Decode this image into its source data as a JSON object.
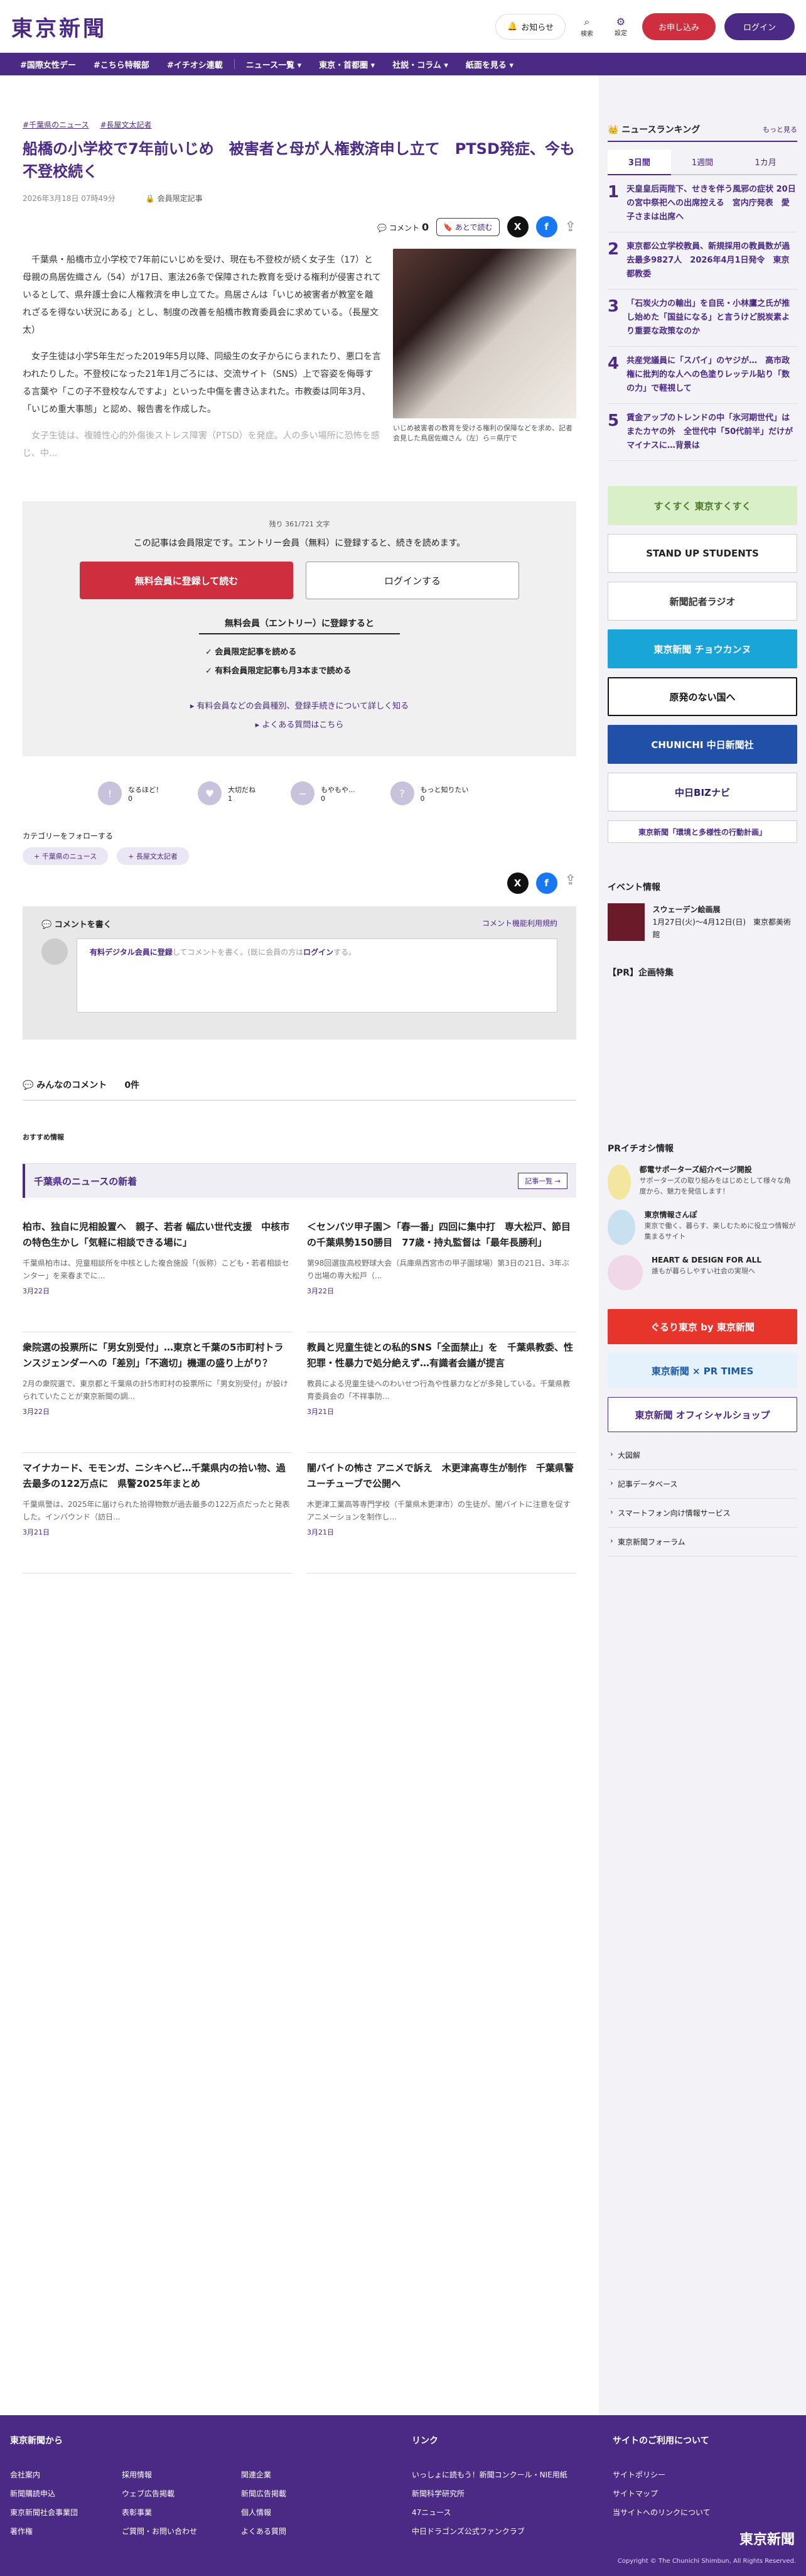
{
  "header": {
    "logo": "東京新聞",
    "notif": "お知らせ",
    "search": "検索",
    "settings": "設定",
    "apply": "お申し込み",
    "login": "ログイン"
  },
  "nav": [
    "#国際女性デー",
    "#こちら特報部",
    "#イチオシ連載",
    "ニュース一覧",
    "東京・首都圏",
    "社説・コラム",
    "紙面を見る"
  ],
  "article": {
    "tags": [
      "千葉県のニュース",
      "長屋文太記者"
    ],
    "title": "船橋の小学校で7年前いじめ　被害者と母が人権救済申し立て　PTSD発症、今も不登校続く",
    "date": "2026年3月18日 07時49分",
    "lock": "会員限定記事",
    "comment_label": "コメント",
    "comment_count": "0",
    "later": "あとで読む",
    "p1": "千葉県・船橋市立小学校で7年前にいじめを受け、現在も不登校が続く女子生（17）と母親の鳥居佐織さん（54）が17日、憲法26条で保障された教育を受ける権利が侵害されているとして、県弁護士会に人権救済を申し立てた。鳥居さんは「いじめ被害者が教室を離れざるを得ない状況にある」とし、制度の改善を船橋市教育委員会に求めている。（長屋文太）",
    "p2": "女子生徒は小学5年生だった2019年5月以降、同級生の女子からにらまれたり、悪口を言われたりした。不登校になった21年1月ごろには、交流サイト（SNS）上で容姿を侮辱する言葉や「この子不登校なんですよ」といった中傷を書き込まれた。市教委は同年3月、「いじめ重大事態」と認め、報告書を作成した。",
    "p3": "女子生徒は、複雑性心的外傷後ストレス障害（PTSD）を発症。人の多い場所に恐怖を感じ、中...",
    "caption": "いじめ被害者の教育を受ける権利の保障などを求め、記者会見した鳥居佐織さん（左）ら＝県庁で"
  },
  "gate": {
    "rest": "残り 361/721 文字",
    "msg": "この記事は会員限定です。エントリー会員（無料）に登録すると、続きを読めます。",
    "register": "無料会員に登録して読む",
    "login": "ログインする",
    "free_title": "無料会員（エントリー）に登録すると",
    "check1": "会員限定記事を読める",
    "check2": "有料会員限定記事も月3本まで読める",
    "link1": "有料会員などの会員種別、登録手続きについて詳しく知る",
    "link2": "よくある質問はこちら"
  },
  "reactions": [
    {
      "label": "なるほど！",
      "count": "0"
    },
    {
      "label": "大切だね",
      "count": "1"
    },
    {
      "label": "もやもや...",
      "count": "0"
    },
    {
      "label": "もっと知りたい",
      "count": "0"
    }
  ],
  "follow": {
    "title": "カテゴリーをフォローする",
    "chips": [
      "千葉県のニュース",
      "長屋文太記者"
    ]
  },
  "comments": {
    "write": "コメントを書く",
    "rules": "コメント機能利用規約",
    "ph1": "有料デジタル会員に登録",
    "ph2": "してコメントを書く。(既に会員の方は",
    "ph3": "ログイン",
    "ph4": "する。",
    "all": "みんなのコメント",
    "count": "0件"
  },
  "rec": "おすすめ情報",
  "news": {
    "title": "千葉県のニュースの新着",
    "more": "記事一覧",
    "items": [
      {
        "t": "柏市、独自に児相設置へ　親子、若者 幅広い世代支援　中核市の特色生かし「気軽に相談できる場に」",
        "b": "千葉県柏市は、児童相談所を中核とした複合施設「(仮称）こども・若者相談センター」を来春までに...",
        "d": "3月22日"
      },
      {
        "t": "＜センバツ甲子園＞「春一番」四回に集中打　専大松戸、節目の千葉県勢150勝目　77歳・持丸監督は「最年長勝利」",
        "b": "第98回選抜高校野球大会（兵庫県西宮市の甲子園球場）第3日の21日、3年ぶり出場の専大松戸（...",
        "d": "3月22日"
      },
      {
        "t": "衆院選の投票所に「男女別受付」…東京と千葉の5市町村トランスジェンダーへの「差別」「不適切」機運の盛り上がり？",
        "b": "2月の衆院選で、東京都と千葉県の計5市町村の投票所に「男女別受付」が設けられていたことが東京新聞の調...",
        "d": "3月22日"
      },
      {
        "t": "教員と児童生徒との私的SNS「全面禁止」を　千葉県教委、性犯罪・性暴力で処分絶えず…有識者会議が提言",
        "b": "教員による児童生徒へのわいせつ行為や性暴力などが多発している。千葉県教育委員会の「不祥事防...",
        "d": "3月21日"
      },
      {
        "t": "マイナカード、モモンガ、ニシキヘビ…千葉県内の拾い物、過去最多の122万点に　県警2025年まとめ",
        "b": "千葉県警は、2025年に届けられた拾得物数が過去最多の122万点だったと発表した。インバウンド（訪日...",
        "d": "3月21日"
      },
      {
        "t": "闇バイトの怖さ アニメで訴え　木更津高専生が制作　千葉県警ユーチューブで公開へ",
        "b": "木更津工業高等専門学校（千葉県木更津市）の生徒が、闇バイトに注意を促すアニメーションを制作し...",
        "d": "3月21日"
      }
    ]
  },
  "ranking": {
    "title": "ニュースランキング",
    "more": "もっと見る",
    "tabs": [
      "3日間",
      "1週間",
      "1カ月"
    ],
    "items": [
      "天皇皇后両陛下、せきを伴う風邪の症状 20日の宮中祭祀への出席控える　宮内庁発表　愛子さまは出席へ",
      "東京都公立学校教員、新規採用の教員数が過去最多9827人　2026年4月1日発令　東京都教委",
      "「石炭火力の輸出」を自民・小林鷹之氏が推し始めた「国益になる」と言うけど脱炭素より重要な政策なのか",
      "共産党議員に「スパイ」のヤジが…　高市政権に批判的な人への色塗りレッテル貼り「数の力」で軽視して",
      "賃金アップのトレンドの中「氷河期世代」はまたカヤの外　全世代中「50代前半」だけがマイナスに…背景は"
    ]
  },
  "banners": [
    "すくすく 東京すくすく",
    "STAND UP STUDENTS",
    "新聞記者ラジオ",
    "東京新聞 チョウカンヌ",
    "原発のない国へ",
    "CHUNICHI 中日新聞社",
    "中日BIZナビ",
    "東京新聞「環境と多様性の行動計画」"
  ],
  "events": {
    "title": "イベント情報",
    "item": "スウェーデン絵画展",
    "sub": "1月27日(火)〜4月12日(日)　東京都美術館"
  },
  "pr": "【PR】企画特集",
  "pri": {
    "title": "PRイチオシ情報",
    "items": [
      {
        "t": "都電サポーターズ紹介ページ開設",
        "s": "サポーターズの取り組みをはじめとして様々な角度から、魅力を発信します！"
      },
      {
        "t": "東京情報さんぽ",
        "s": "東京で働く、暮らす、楽しむために役立つ情報が集まるサイト"
      },
      {
        "t": "HEART & DESIGN FOR ALL",
        "s": "誰もが暮らしやすい社会の実現へ"
      }
    ]
  },
  "banners2": [
    "ぐるり東京 by 東京新聞",
    "東京新聞 × PR TIMES",
    "東京新聞 オフィシャルショップ"
  ],
  "slinks": [
    "大図解",
    "記事データベース",
    "スマートフォン向け情報サービス",
    "東京新聞フォーラム"
  ],
  "footer": {
    "h1": "東京新聞から",
    "c1": [
      "会社案内",
      "新聞購読申込",
      "東京新聞社会事業団",
      "著作権"
    ],
    "c2": [
      "採用情報",
      "ウェブ広告掲載",
      "表彰事業",
      "ご質問・お問い合わせ"
    ],
    "c3": [
      "関連企業",
      "新聞広告掲載",
      "個人情報",
      "よくある質問"
    ],
    "h2": "リンク",
    "c4": [
      "いっしょに読もう！新聞コンクール・NIE用紙",
      "新聞科学研究所",
      "47ニュース",
      "中日ドラゴンズ公式ファンクラブ"
    ],
    "h3": "サイトのご利用について",
    "c5": [
      "サイトポリシー",
      "サイトマップ",
      "当サイトへのリンクについて"
    ],
    "logo": "東京新聞",
    "copy": "Copyright © The Chunichi Shimbun, All Rights Reserved."
  }
}
